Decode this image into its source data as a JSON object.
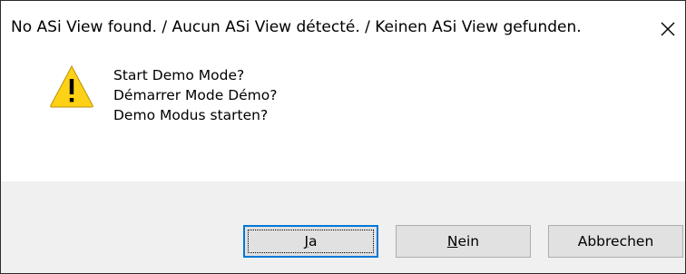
{
  "window": {
    "title": "No ASi View found. / Aucun ASi View détecté. / Keinen ASi View gefunden."
  },
  "icons": {
    "close": "close-icon",
    "warning": "warning-icon"
  },
  "message": {
    "lines": [
      "Start Demo Mode?",
      "Démarrer Mode Démo?",
      "Demo Modus starten?"
    ]
  },
  "buttons": {
    "ja": {
      "mnemonic": "J",
      "rest": "a"
    },
    "nein": {
      "mnemonic": "N",
      "rest": "ein"
    },
    "abbrechen": {
      "label": "Abbrechen"
    }
  },
  "colors": {
    "warning_fill": "#fcd116",
    "default_button_border": "#0078d7",
    "footer_background": "#f0f0f0"
  }
}
